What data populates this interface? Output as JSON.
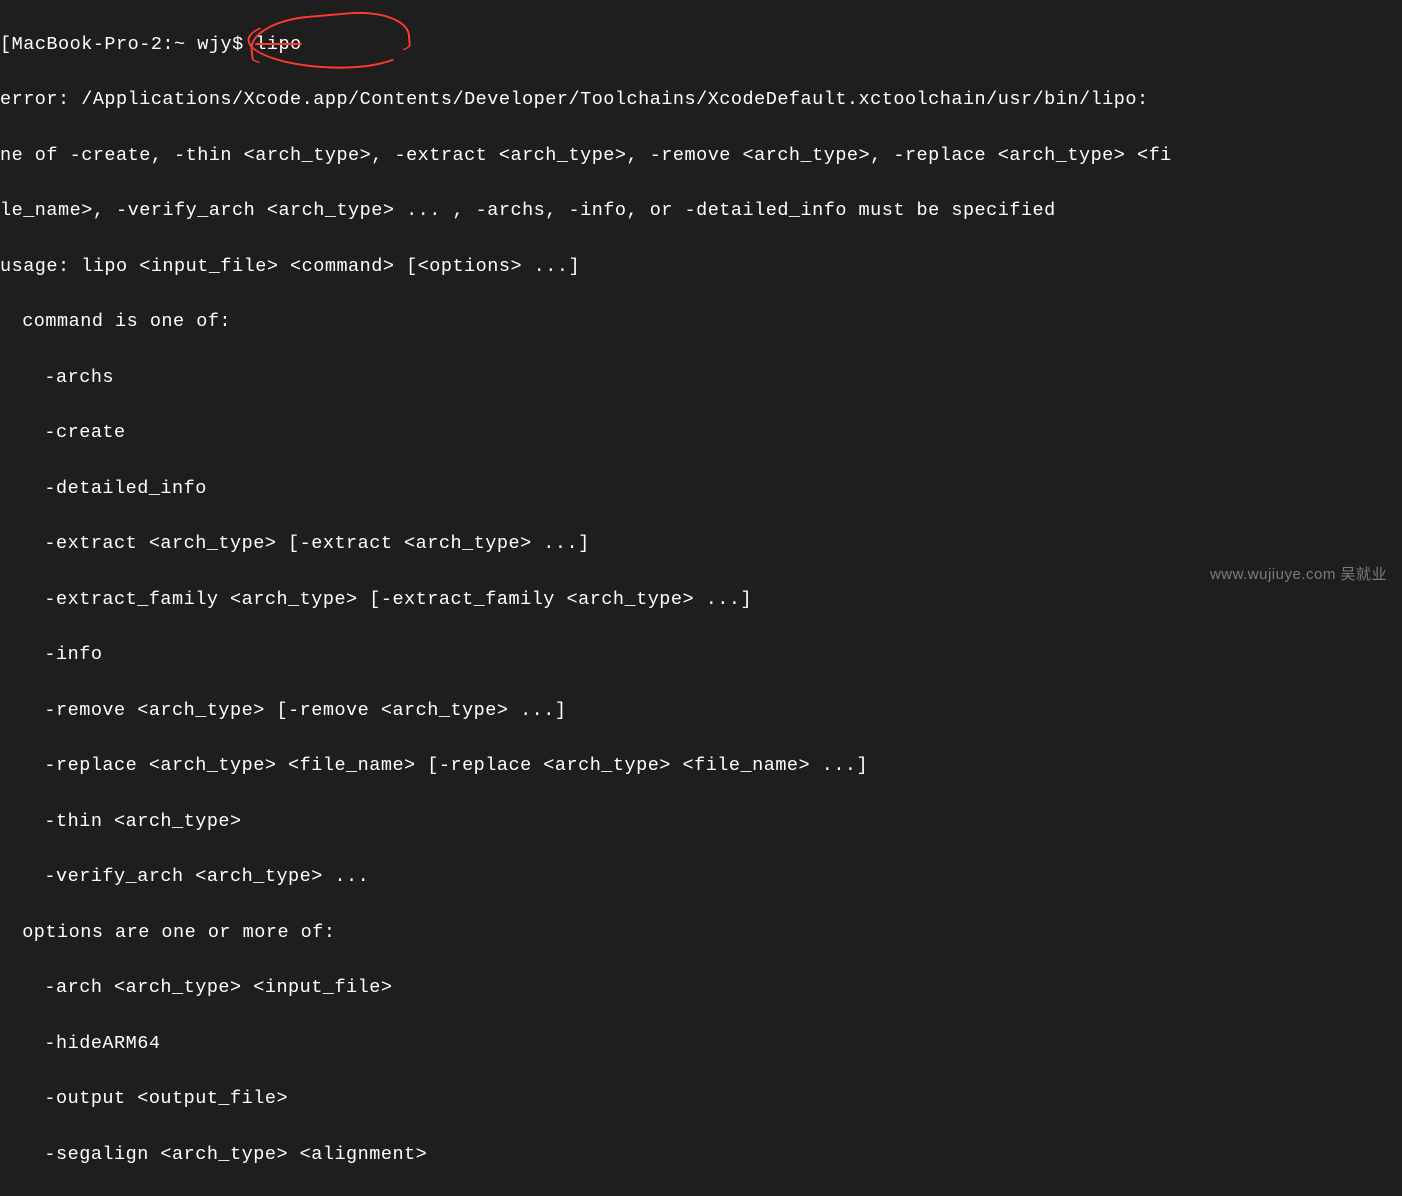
{
  "prompt": {
    "bracket": "[",
    "host": "MacBook-Pro-2:",
    "path": "~",
    "user": "wjy$",
    "command": "lipo"
  },
  "output": {
    "error_line1": "error: /Applications/Xcode.app/Contents/Developer/Toolchains/XcodeDefault.xctoolchain/usr/bin/lipo: ",
    "error_line2": "ne of -create, -thin <arch_type>, -extract <arch_type>, -remove <arch_type>, -replace <arch_type> <fi",
    "error_line3": "le_name>, -verify_arch <arch_type> ... , -archs, -info, or -detailed_info must be specified",
    "usage": "usage: lipo <input_file> <command> [<options> ...]",
    "command_header": "command is one of:",
    "commands": [
      "-archs",
      "-create",
      "-detailed_info",
      "-extract <arch_type> [-extract <arch_type> ...]",
      "-extract_family <arch_type> [-extract_family <arch_type> ...]",
      "-info",
      "-remove <arch_type> [-remove <arch_type> ...]",
      "-replace <arch_type> <file_name> [-replace <arch_type> <file_name> ...]",
      "-thin <arch_type>",
      "-verify_arch <arch_type> ..."
    ],
    "options_header": "options are one or more of:",
    "options": [
      "-arch <arch_type> <input_file>",
      "-hideARM64",
      "-output <output_file>",
      "-segalign <arch_type> <alignment>"
    ]
  },
  "watermark": "www.wujiuye.com 吴就业"
}
